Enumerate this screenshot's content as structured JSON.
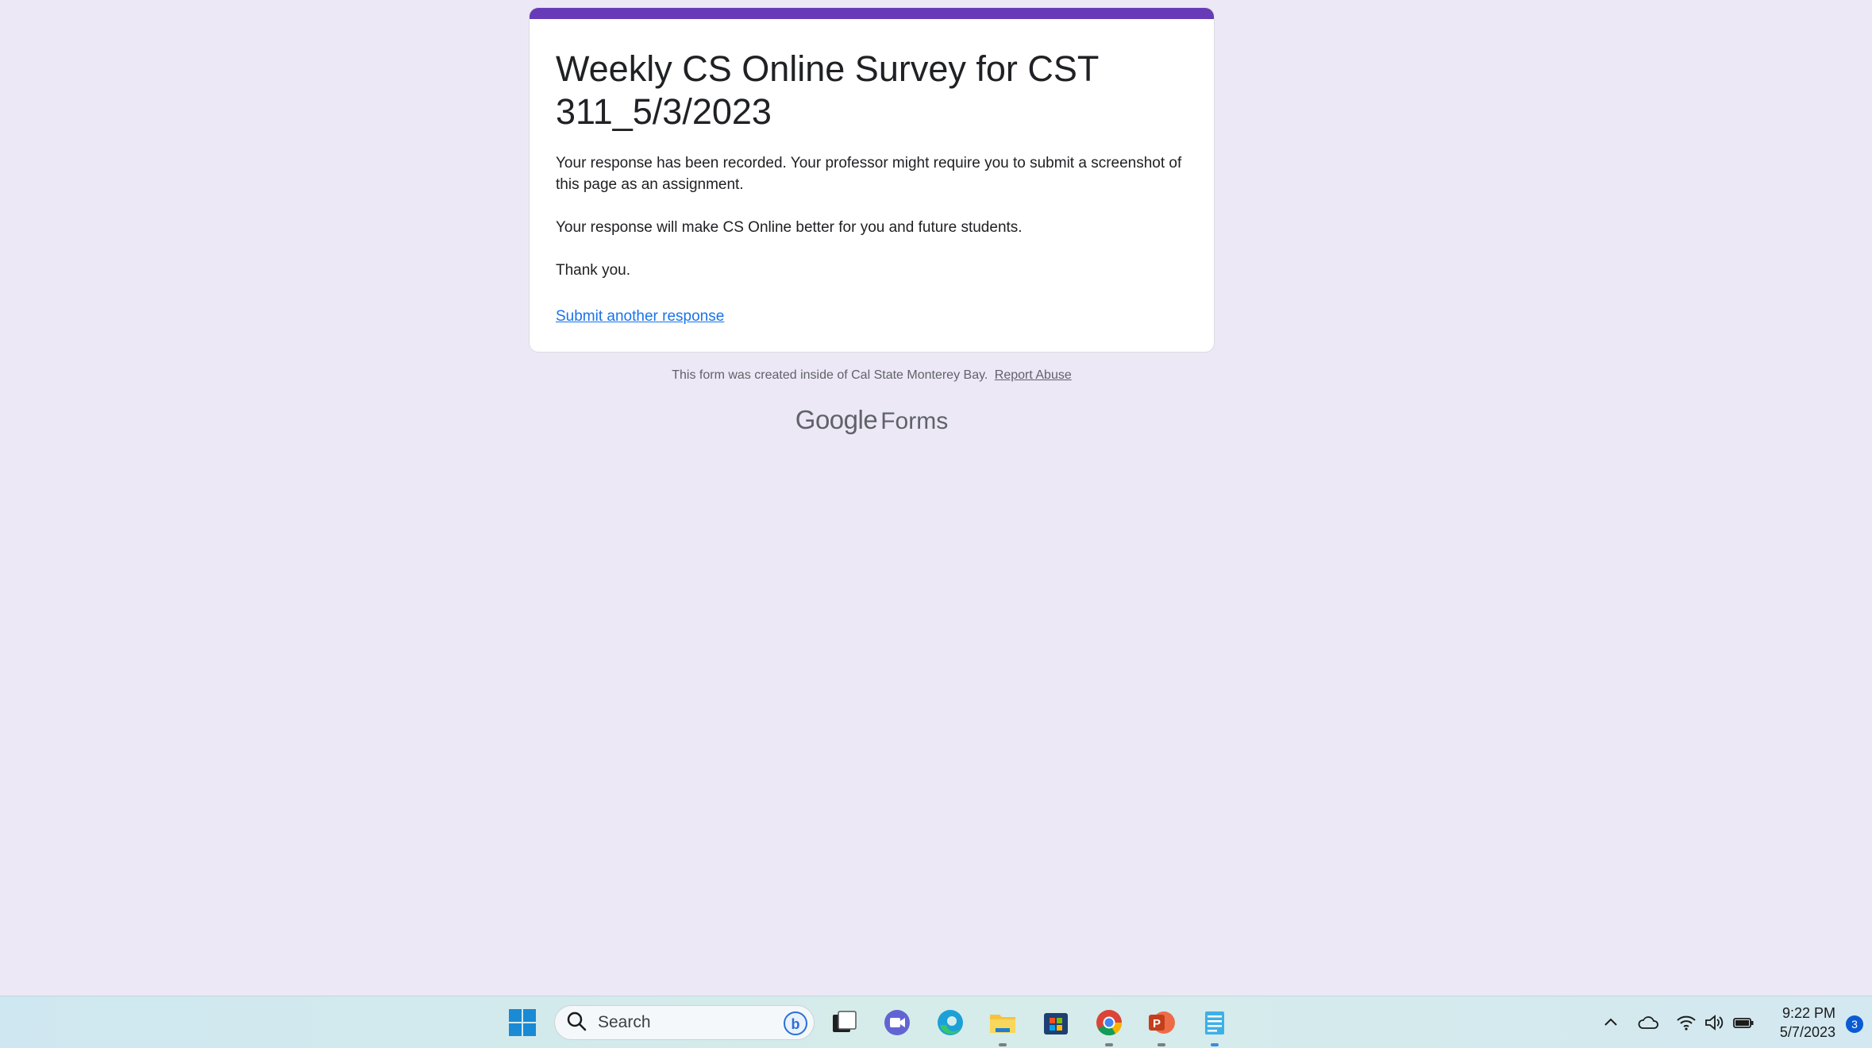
{
  "form": {
    "title": "Weekly CS Online Survey for CST 311_5/3/2023",
    "message_1": "Your response has been recorded. Your professor might require you to submit a screenshot of this page as an assignment.",
    "message_2": "Your response will make CS Online better for you and future students.",
    "message_3": "Thank you.",
    "submit_another_label": "Submit another response",
    "accent_color": "#673ab7"
  },
  "footer": {
    "created_note": "This form was created inside of Cal State Monterey Bay.",
    "report_abuse_label": "Report Abuse",
    "brand_google": "Google",
    "brand_forms": "Forms"
  },
  "taskbar": {
    "search_placeholder": "Search",
    "pinned_apps": [
      "start-icon",
      "task-view-icon",
      "teams-chat-icon",
      "edge-icon",
      "file-explorer-icon",
      "store-icon",
      "chrome-icon",
      "powerpoint-icon",
      "notepad-icon"
    ],
    "time": "9:22 PM",
    "date": "5/7/2023",
    "notification_count": "3"
  }
}
